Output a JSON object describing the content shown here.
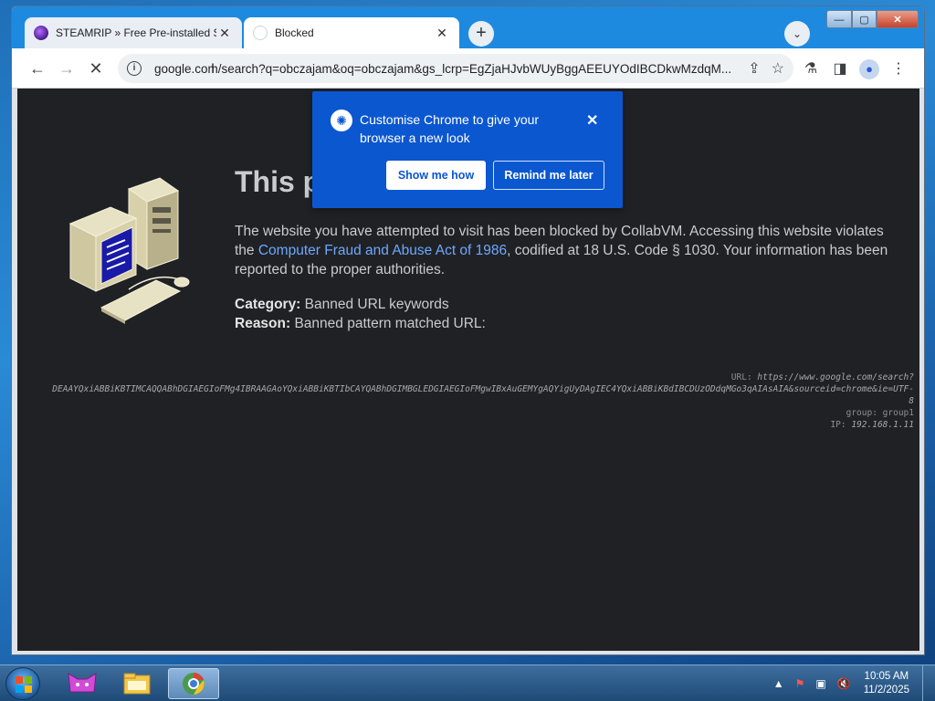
{
  "browser": {
    "tabs": [
      {
        "title": "STEAMRIP » Free Pre-installed S",
        "close": "✕"
      },
      {
        "title": "Blocked",
        "close": "✕"
      }
    ],
    "new_tab": "+",
    "tab_search": "⌄",
    "window_controls": {
      "minimize": "—",
      "maximize": "▢",
      "close": "✕"
    },
    "nav": {
      "back": "←",
      "forward": "→",
      "reload": "✕"
    },
    "url": "google.com/search?q=obczajam&oq=obczajam&gs_lcrp=EgZjaHJvbWUyBggAEEUYOdIBCDkwMzdqM...",
    "url_actions": {
      "share": "⇪",
      "bookmark": "☆"
    },
    "toolbar_icons": {
      "labs": "⚗",
      "sidepanel": "◨",
      "profile": "●",
      "menu": "⋮"
    }
  },
  "page": {
    "title": "This p",
    "para_before_link": "The website you have attempted to visit has been blocked by CollabVM. Accessing this website violates the ",
    "link": "Computer Fraud and Abuse Act of 1986",
    "para_after_link": ", codified at 18 U.S. Code § 1030. Your information has been reported to the proper authorities.",
    "category_label": "Category:",
    "category_value": "Banned URL keywords",
    "reason_label": "Reason:",
    "reason_value": "Banned pattern matched URL:",
    "debug": {
      "url_label": "URL:",
      "url_value_1": "https://www.google.com/search?",
      "url_value_2": "DEAAYQxiABBiKBTIMCAQQABhDGIAEGIoFMg4IBRAAGAoYQxiABBiKBTIbCAYQABhDGIMBGLEDGIAEGIoFMgwIBxAuGEMYgAQYigUyDAgIEC4YQxiABBiKBdIBCDUzODdqMGo3qAIAsAIA&sourceid=chrome&ie=UTF-",
      "url_value_3": "8",
      "group_label": "group:",
      "group_value": "group1",
      "ip_label": "IP:",
      "ip_value": "192.168.1.11"
    }
  },
  "popup": {
    "message": "Customise Chrome to give your browser a new look",
    "primary": "Show me how",
    "secondary": "Remind me later",
    "close": "✕"
  },
  "taskbar": {
    "time": "10:05 AM",
    "date": "11/2/2025",
    "tray_up": "▲",
    "tray_flag": "⚑",
    "tray_network": "▣",
    "tray_volume": "🔇"
  }
}
